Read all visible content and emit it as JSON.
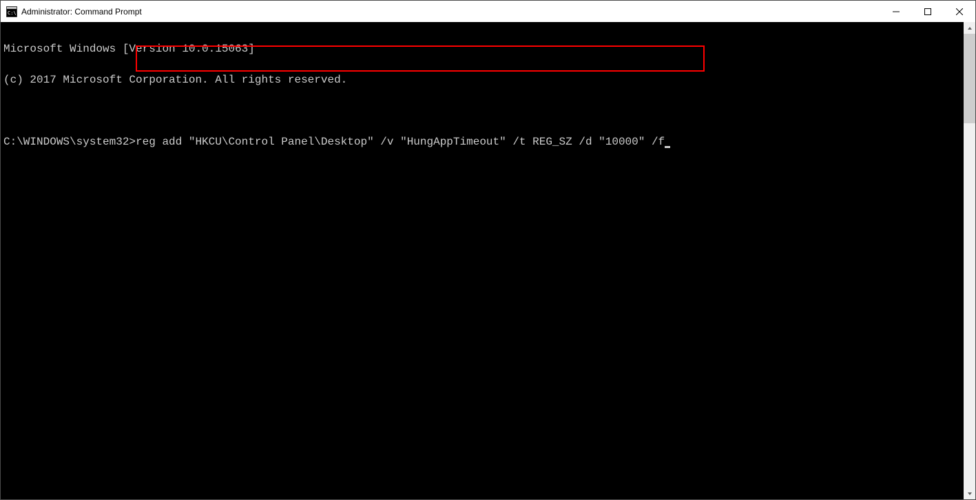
{
  "titlebar": {
    "title": "Administrator: Command Prompt"
  },
  "terminal": {
    "line1": "Microsoft Windows [Version 10.0.15063]",
    "line2": "(c) 2017 Microsoft Corporation. All rights reserved.",
    "blank": "",
    "prompt": "C:\\WINDOWS\\system32>",
    "command": "reg add \"HKCU\\Control Panel\\Desktop\" /v \"HungAppTimeout\" /t REG_SZ /d \"10000\" /f"
  }
}
